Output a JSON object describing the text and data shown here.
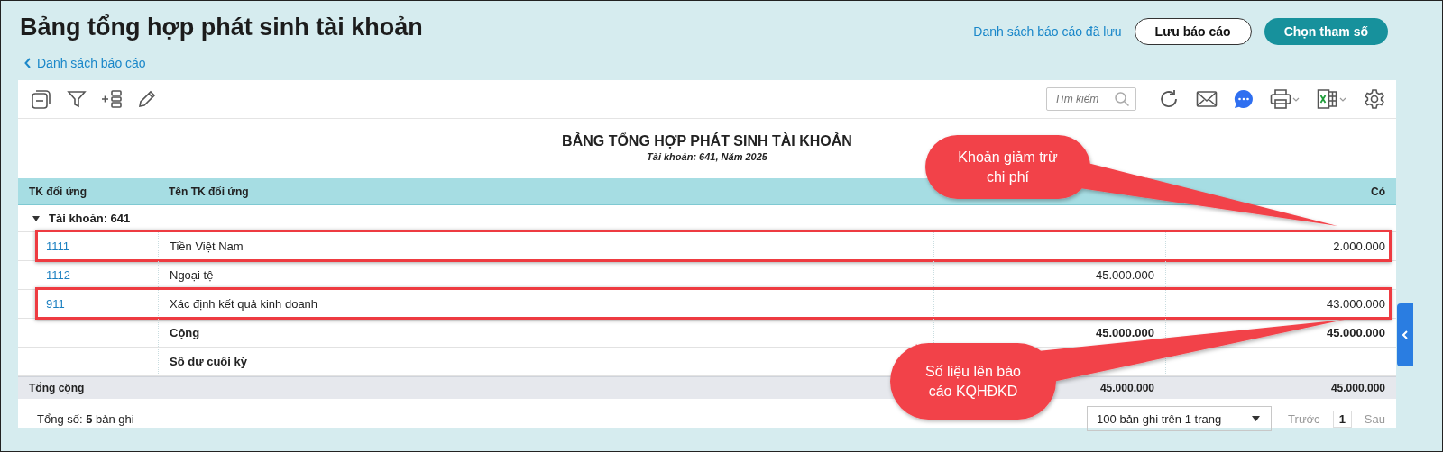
{
  "page": {
    "title": "Bảng tổng hợp phát sinh tài khoản",
    "back_link": "Danh sách báo cáo"
  },
  "header_actions": {
    "saved_reports_link": "Danh sách báo cáo đã lưu",
    "save_button": "Lưu báo cáo",
    "params_button": "Chọn tham số"
  },
  "toolbar": {
    "search": {
      "placeholder": "Tìm kiếm"
    }
  },
  "report": {
    "title": "BẢNG TỔNG HỢP PHÁT SINH TÀI KHOẢN",
    "subtitle": "Tài khoản: 641, Năm 2025"
  },
  "table": {
    "columns": {
      "account": "TK đối ứng",
      "account_name": "Tên TK đối ứng",
      "credit": "Có"
    },
    "group": {
      "label": "Tài khoản: 641",
      "expanded": true
    },
    "rows": [
      {
        "kind": "entry",
        "account": "1111",
        "name": "Tiền Việt Nam",
        "credit": "2.000.000",
        "highlighted": true
      },
      {
        "kind": "entry",
        "account": "1112",
        "name": "Ngoại tệ",
        "column_3": "45.000.000",
        "highlighted": false
      },
      {
        "kind": "entry",
        "account": "911",
        "name": "Xác định kết quả kinh doanh",
        "credit": "43.000.000",
        "highlighted": true
      },
      {
        "kind": "summary",
        "name": "Cộng",
        "column_3": "45.000.000",
        "credit": "45.000.000",
        "highlighted": false
      },
      {
        "kind": "summary",
        "name": "Số dư cuối kỳ",
        "highlighted": false
      }
    ],
    "total": {
      "label": "Tổng cộng",
      "column_3": "45.000.000",
      "credit": "45.000.000"
    }
  },
  "footer": {
    "count_label": "Tổng số: **5** bản ghi",
    "page_size": "100 bản ghi trên 1 trang",
    "prev": {
      "label": "Trước",
      "disabled": true
    },
    "page": "1",
    "next": {
      "label": "Sau",
      "disabled": true
    }
  },
  "callouts": [
    {
      "text": "Khoản giảm trừ chi phí"
    },
    {
      "text": "Số liệu lên báo cáo KQHĐKD"
    }
  ]
}
